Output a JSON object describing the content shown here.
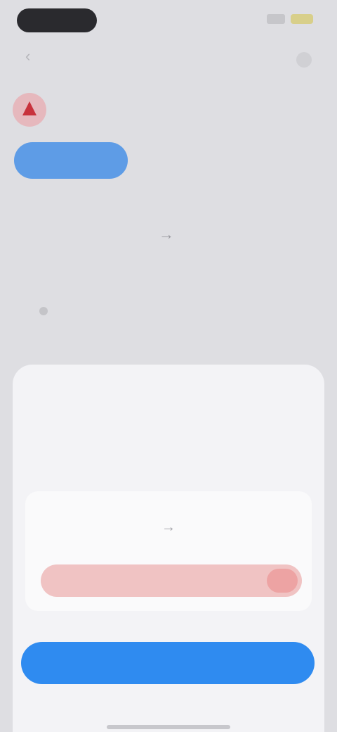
{
  "status_bar": {
    "time": ""
  },
  "header": {
    "token_name": "",
    "token_sub": ""
  },
  "tabs": [
    {
      "label": "",
      "active": true
    },
    {
      "label": "",
      "active": false
    },
    {
      "label": "",
      "active": false
    }
  ],
  "summary": {
    "from_amount": "",
    "from_label": "",
    "to_amount": "",
    "to_label": "",
    "route": ""
  },
  "sheet": {
    "title": "",
    "description": "",
    "detail_from": "",
    "detail_to": "",
    "warning": "",
    "confirm_label": ""
  },
  "colors": {
    "primary_blue": "#2f8bf0",
    "warning_red": "#e06a6a",
    "sheet_background": "#f3f3f6"
  }
}
